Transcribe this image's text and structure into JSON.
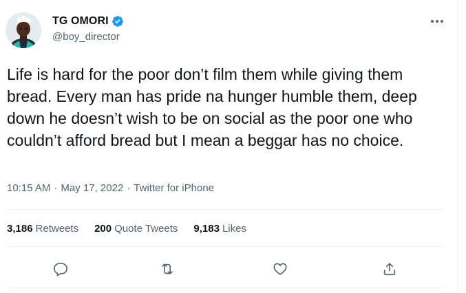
{
  "author": {
    "display_name": "TG OMORI",
    "handle": "@boy_director",
    "verified": true
  },
  "tweet": {
    "text": "Life is hard for the poor don’t film them while giving them bread. Every man has pride na hunger humble them, deep down he doesn’t wish to be on social as the poor one who couldn’t afford bread but I mean a beggar has no choice.",
    "time": "10:15 AM",
    "date": "May 17, 2022",
    "source": "Twitter for iPhone",
    "separator": "·"
  },
  "stats": {
    "retweets_count": "3,186",
    "retweets_label": "Retweets",
    "quotes_count": "200",
    "quotes_label": "Quote Tweets",
    "likes_count": "9,183",
    "likes_label": "Likes"
  },
  "icons": {
    "reply": "reply-icon",
    "retweet": "retweet-icon",
    "like": "heart-icon",
    "share": "share-icon",
    "more": "more-icon",
    "verified": "verified-badge-icon"
  },
  "colors": {
    "text": "#0f1419",
    "secondary": "#536471",
    "verified": "#1d9bf0",
    "divider": "#eff3f4"
  }
}
